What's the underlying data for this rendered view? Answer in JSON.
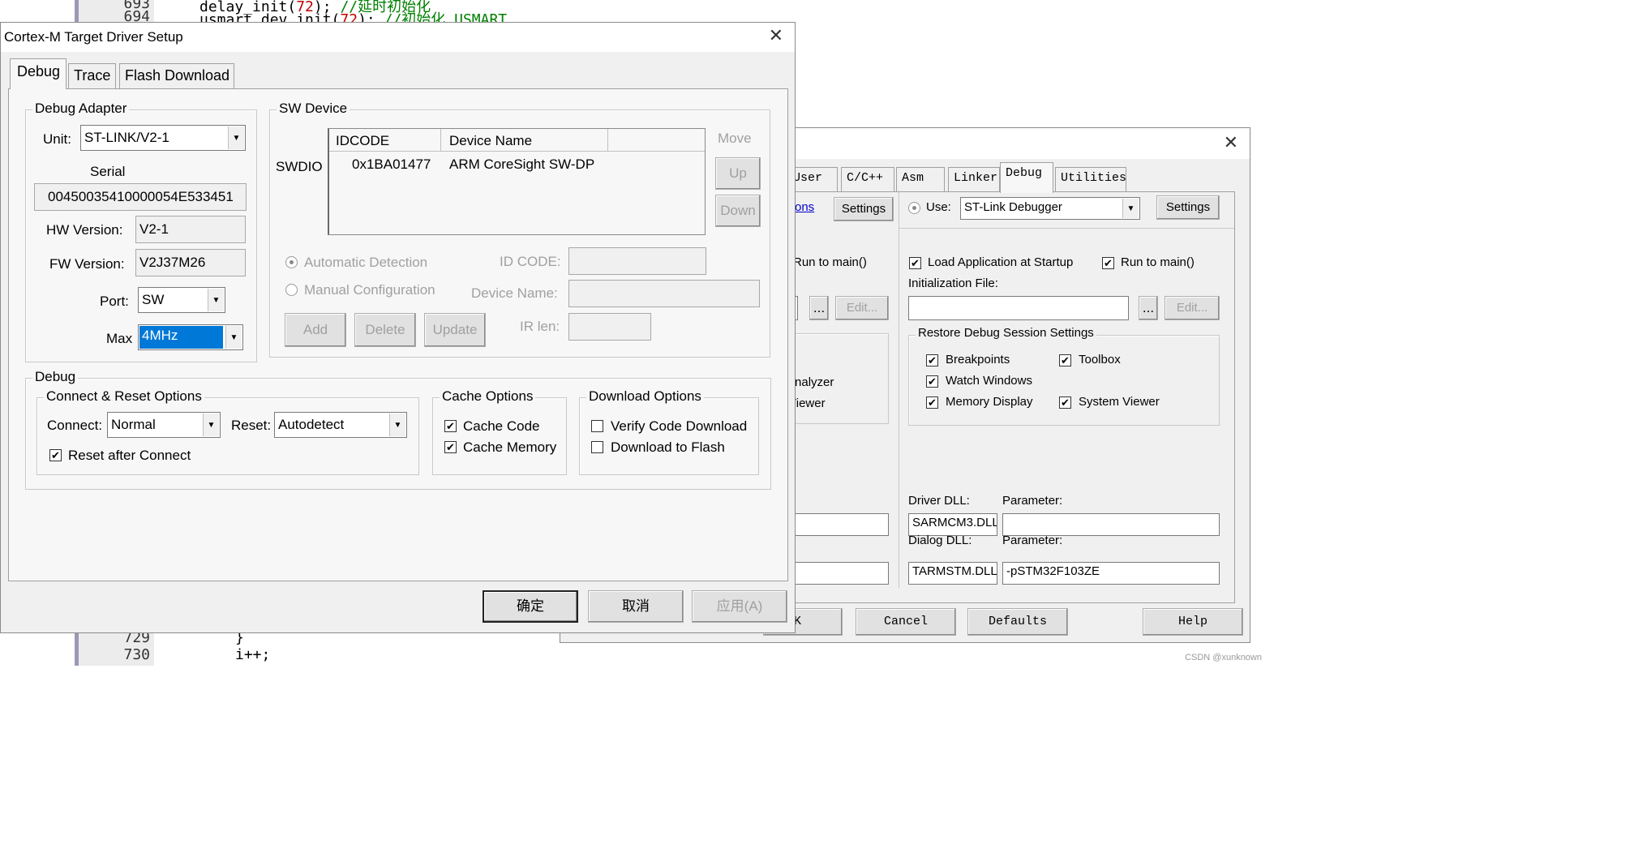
{
  "editor": {
    "lines": [
      {
        "num": "693",
        "code_pre": "delay_init(",
        "arg": "72",
        "code_post": ");",
        "comment": "//延时初始化"
      },
      {
        "num": "694",
        "code_pre": "usmart_dev.init(",
        "arg": "72",
        "code_post": ");",
        "comment": "//初始化 USMART"
      },
      {
        "num": "729",
        "code": "}"
      },
      {
        "num": "730",
        "code": "i++;"
      }
    ]
  },
  "main_dialog": {
    "title": "Cortex-M Target Driver Setup",
    "tabs": [
      "Debug",
      "Trace",
      "Flash Download"
    ],
    "debug_adapter": {
      "legend": "Debug Adapter",
      "unit_label": "Unit:",
      "unit_value": "ST-LINK/V2-1",
      "serial_label": "Serial",
      "serial_value": "00450035410000054E533451",
      "hw_label": "HW Version:",
      "hw_value": "V2-1",
      "fw_label": "FW Version:",
      "fw_value": "V2J37M26",
      "port_label": "Port:",
      "port_value": "SW",
      "max_label": "Max",
      "max_value": "4MHz"
    },
    "sw_device": {
      "legend": "SW Device",
      "swdio_label": "SWDIO",
      "col_idcode": "IDCODE",
      "col_device": "Device Name",
      "row_idcode": "0x1BA01477",
      "row_device": "ARM CoreSight SW-DP",
      "move_label": "Move",
      "up_label": "Up",
      "down_label": "Down",
      "auto_detect": "Automatic Detection",
      "manual_config": "Manual Configuration",
      "id_code_label": "ID CODE:",
      "device_name_label": "Device Name:",
      "ir_len_label": "IR len:",
      "add_label": "Add",
      "delete_label": "Delete",
      "update_label": "Update"
    },
    "debug": {
      "legend": "Debug",
      "connect_reset_legend": "Connect & Reset Options",
      "connect_label": "Connect:",
      "connect_value": "Normal",
      "reset_label": "Reset:",
      "reset_value": "Autodetect",
      "reset_after_connect": "Reset after Connect",
      "cache_legend": "Cache Options",
      "cache_code": "Cache Code",
      "cache_memory": "Cache Memory",
      "download_legend": "Download Options",
      "verify_code": "Verify Code Download",
      "download_flash": "Download to Flash"
    },
    "buttons": {
      "ok": "确定",
      "cancel": "取消",
      "apply": "应用(A)"
    }
  },
  "back_dialog": {
    "tabs": [
      "User",
      "C/C++",
      "Asm",
      "Linker",
      "Debug",
      "Utilities"
    ],
    "left_link": "ons",
    "left_settings": "Settings",
    "left_run_to_main": "Run to main()",
    "left_browse": "...",
    "left_edit": "Edit...",
    "left_analyzer": "Analyzer",
    "left_viewer": "Viewer",
    "use_label": "Use:",
    "use_value": "ST-Link Debugger",
    "settings_label": "Settings",
    "load_app": "Load Application at Startup",
    "run_to_main": "Run to main()",
    "init_file_label": "Initialization File:",
    "browse_label": "...",
    "edit_label": "Edit...",
    "restore_legend": "Restore Debug Session Settings",
    "breakpoints": "Breakpoints",
    "toolbox": "Toolbox",
    "watch_windows": "Watch Windows",
    "memory_display": "Memory Display",
    "system_viewer": "System Viewer",
    "driver_dll_label": "Driver DLL:",
    "driver_param_label": "Parameter:",
    "driver_dll_value": "SARMCM3.DLL",
    "driver_param_value": "",
    "dialog_dll_label": "Dialog DLL:",
    "dialog_param_label": "Parameter:",
    "dialog_dll_value": "TARMSTM.DLL",
    "dialog_param_value": "-pSTM32F103ZE",
    "ok_fragment": "K",
    "cancel": "Cancel",
    "defaults": "Defaults",
    "help": "Help"
  },
  "watermark": "CSDN @xunknown"
}
